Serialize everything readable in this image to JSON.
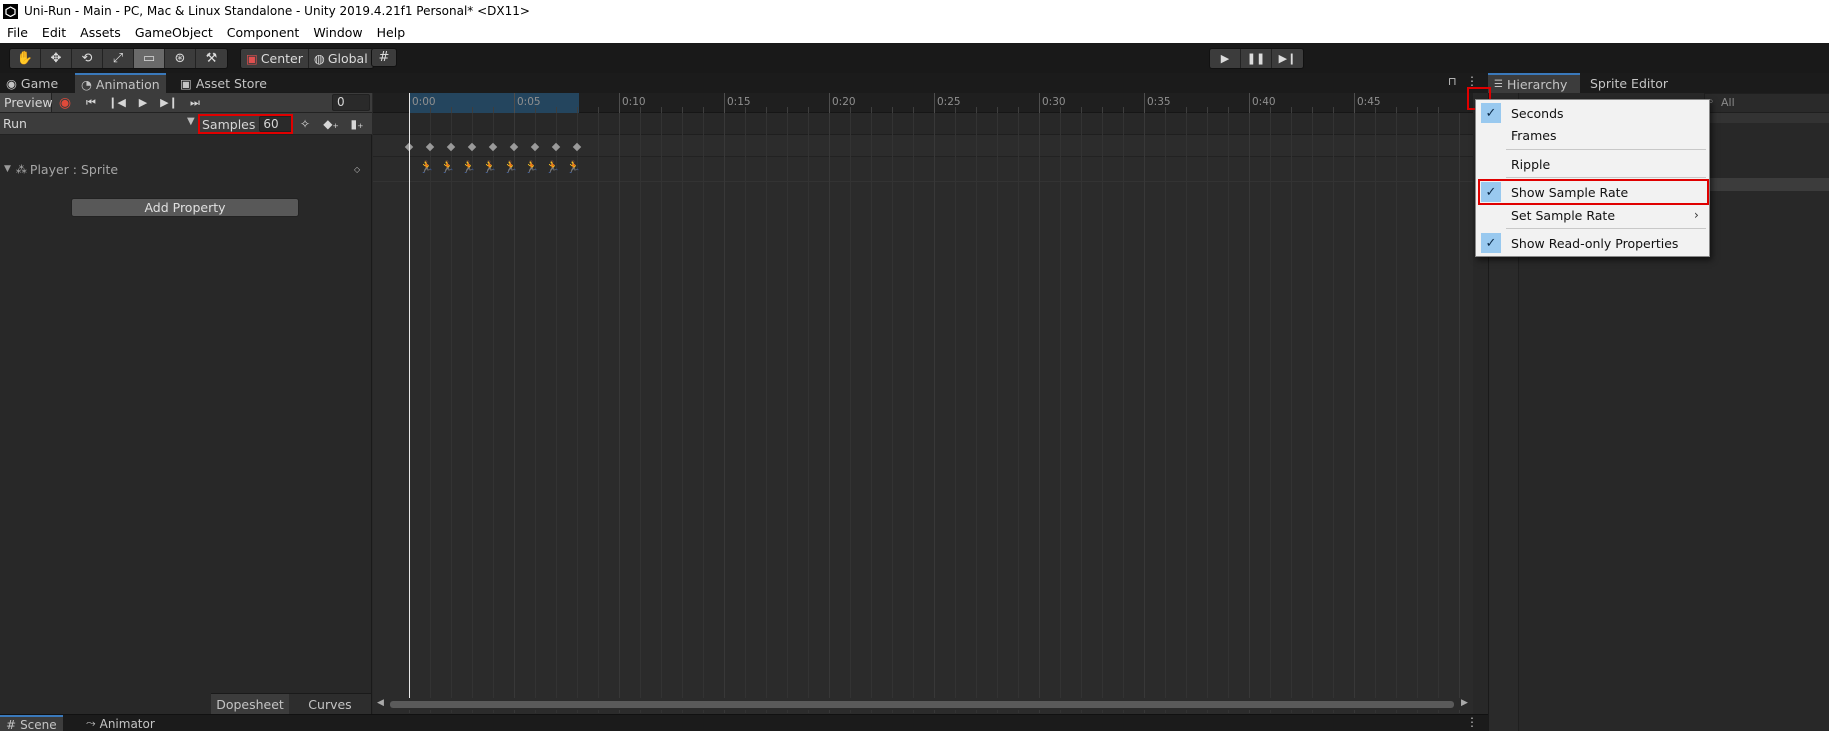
{
  "window": {
    "title": "Uni-Run - Main - PC, Mac & Linux Standalone - Unity 2019.4.21f1 Personal* <DX11>"
  },
  "menu": [
    "File",
    "Edit",
    "Assets",
    "GameObject",
    "Component",
    "Window",
    "Help"
  ],
  "toolbar": {
    "tools": [
      {
        "name": "hand-tool",
        "icon": "✋"
      },
      {
        "name": "move-tool",
        "icon": "✥"
      },
      {
        "name": "rotate-tool",
        "icon": "⟲"
      },
      {
        "name": "scale-tool",
        "icon": "⤢"
      },
      {
        "name": "rect-tool",
        "icon": "▭"
      },
      {
        "name": "transform-tool",
        "icon": "⊛"
      },
      {
        "name": "custom-tool",
        "icon": "⚒"
      }
    ],
    "pivot_label": "Center",
    "space_label": "Global"
  },
  "tabs": {
    "game": "Game",
    "animation": "Animation",
    "asset_store": "Asset Store",
    "hierarchy": "Hierarchy",
    "sprite_editor": "Sprite Editor",
    "scene": "Scene",
    "animator": "Animator"
  },
  "animation": {
    "preview_label": "Preview",
    "frame_value": "0",
    "clip_name": "Run",
    "samples_label": "Samples",
    "samples_value": "60",
    "property_label": "Player : Sprite",
    "add_property_label": "Add Property",
    "dopesheet_label": "Dopesheet",
    "curves_label": "Curves"
  },
  "timeline": {
    "ticks": [
      "0:00",
      "0:05",
      "0:10",
      "0:15",
      "0:20",
      "0:25",
      "0:30",
      "0:35",
      "0:40",
      "0:45"
    ],
    "keyframe_count": 8
  },
  "search": {
    "placeholder": "All"
  },
  "dropdown": {
    "items": [
      {
        "label": "Seconds",
        "checked": true
      },
      {
        "label": "Frames",
        "checked": false
      },
      {
        "label": "Ripple",
        "checked": false
      },
      {
        "label": "Show Sample Rate",
        "checked": true
      },
      {
        "label": "Set Sample Rate",
        "checked": false,
        "submenu": true
      },
      {
        "label": "Show Read-only Properties",
        "checked": true
      }
    ]
  },
  "colors": {
    "accent": "#3a79bb",
    "highlight": "#e00000",
    "check_bg": "#99c9ef"
  }
}
